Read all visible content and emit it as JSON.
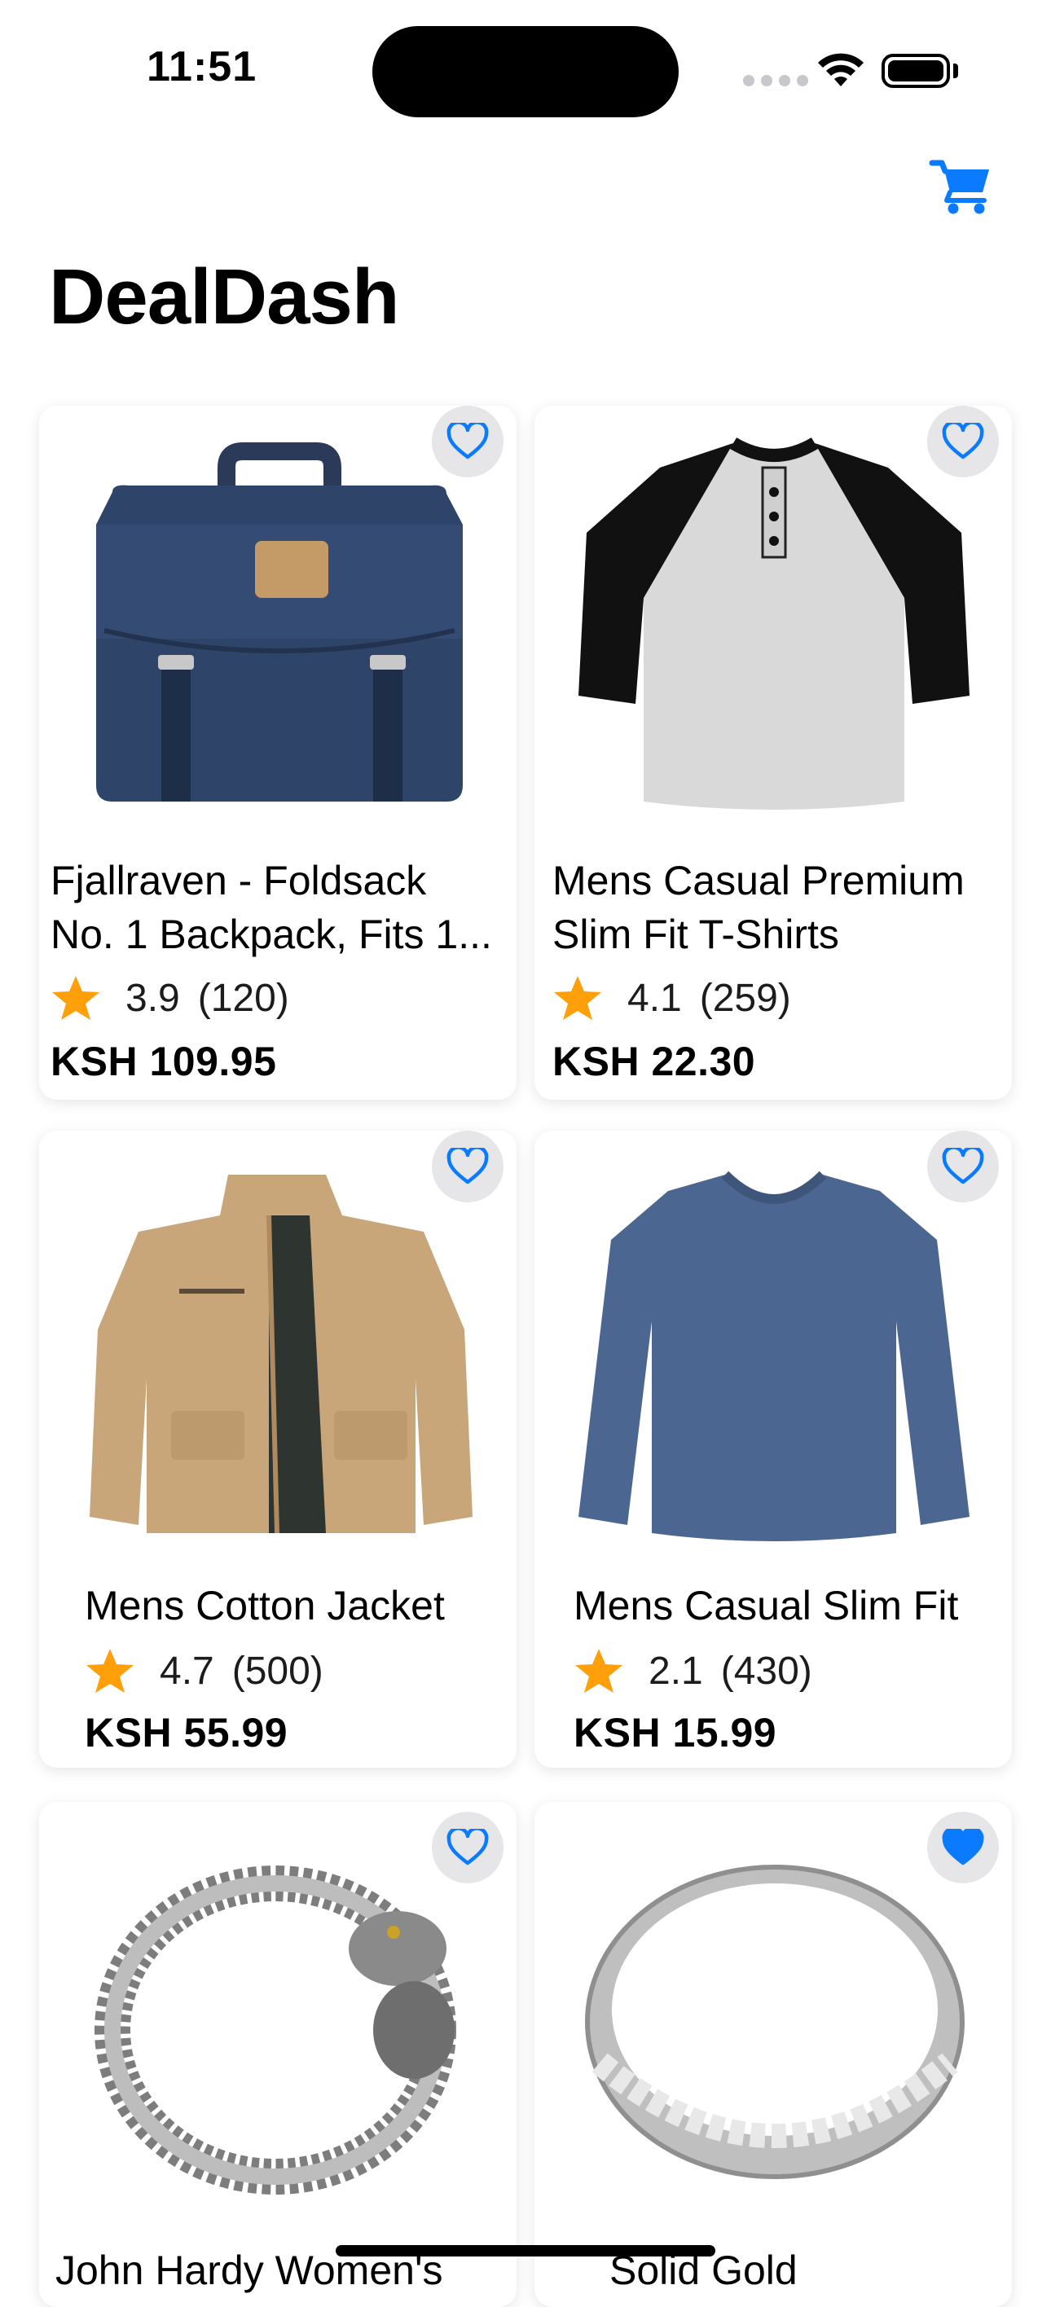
{
  "status_bar": {
    "time": "11:51"
  },
  "app": {
    "title": "DealDash",
    "cart_icon": "cart-icon"
  },
  "colors": {
    "accent": "#0a7aff",
    "star": "#ff9f0a"
  },
  "products": [
    {
      "title_line1": "Fjallraven - Foldsack",
      "title_line2": "No. 1 Backpack, Fits 1...",
      "rating": "3.9",
      "count": "(120)",
      "price": "KSH 109.95",
      "favorite": false
    },
    {
      "title_line1": "Mens Casual Premium",
      "title_line2": "Slim Fit T-Shirts",
      "rating": "4.1",
      "count": "(259)",
      "price": "KSH 22.30",
      "favorite": false
    },
    {
      "title_line1": "Mens Cotton Jacket",
      "rating": "4.7",
      "count": "(500)",
      "price": "KSH 55.99",
      "favorite": false
    },
    {
      "title_line1": "Mens Casual Slim Fit",
      "rating": "2.1",
      "count": "(430)",
      "price": "KSH 15.99",
      "favorite": false
    },
    {
      "title_line1": "John Hardy Women's",
      "favorite": false
    },
    {
      "title_line1": "Solid Gold",
      "favorite": true
    }
  ]
}
